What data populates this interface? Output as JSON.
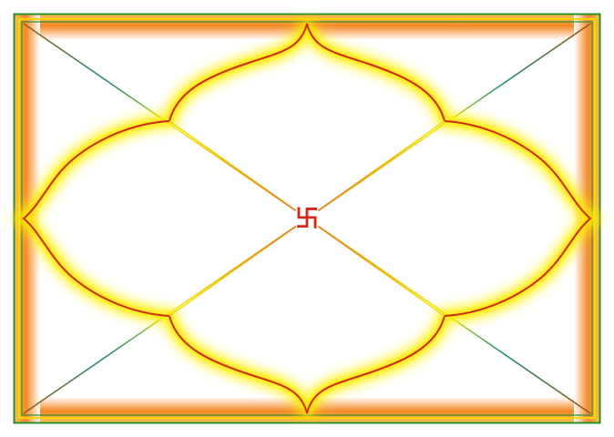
{
  "chart": {
    "center_symbol": "卐",
    "colors": {
      "outer_frame": "#2e8b2e",
      "inner_frame": "#2e8b2e",
      "border_glow_outer": "#ffffff",
      "border_glow_inner": "#f58a2a",
      "border_glow_edge": "#ffd400",
      "diagonal_corner": "#1e8f7a",
      "diagonal_mid": "#f2e600",
      "diagonal_center": "#e0781a",
      "lotus_outline": "#cc2a14",
      "lotus_glow": "#fff200",
      "lotus_fill": "#ffffff",
      "symbol": "#d2281a"
    }
  }
}
